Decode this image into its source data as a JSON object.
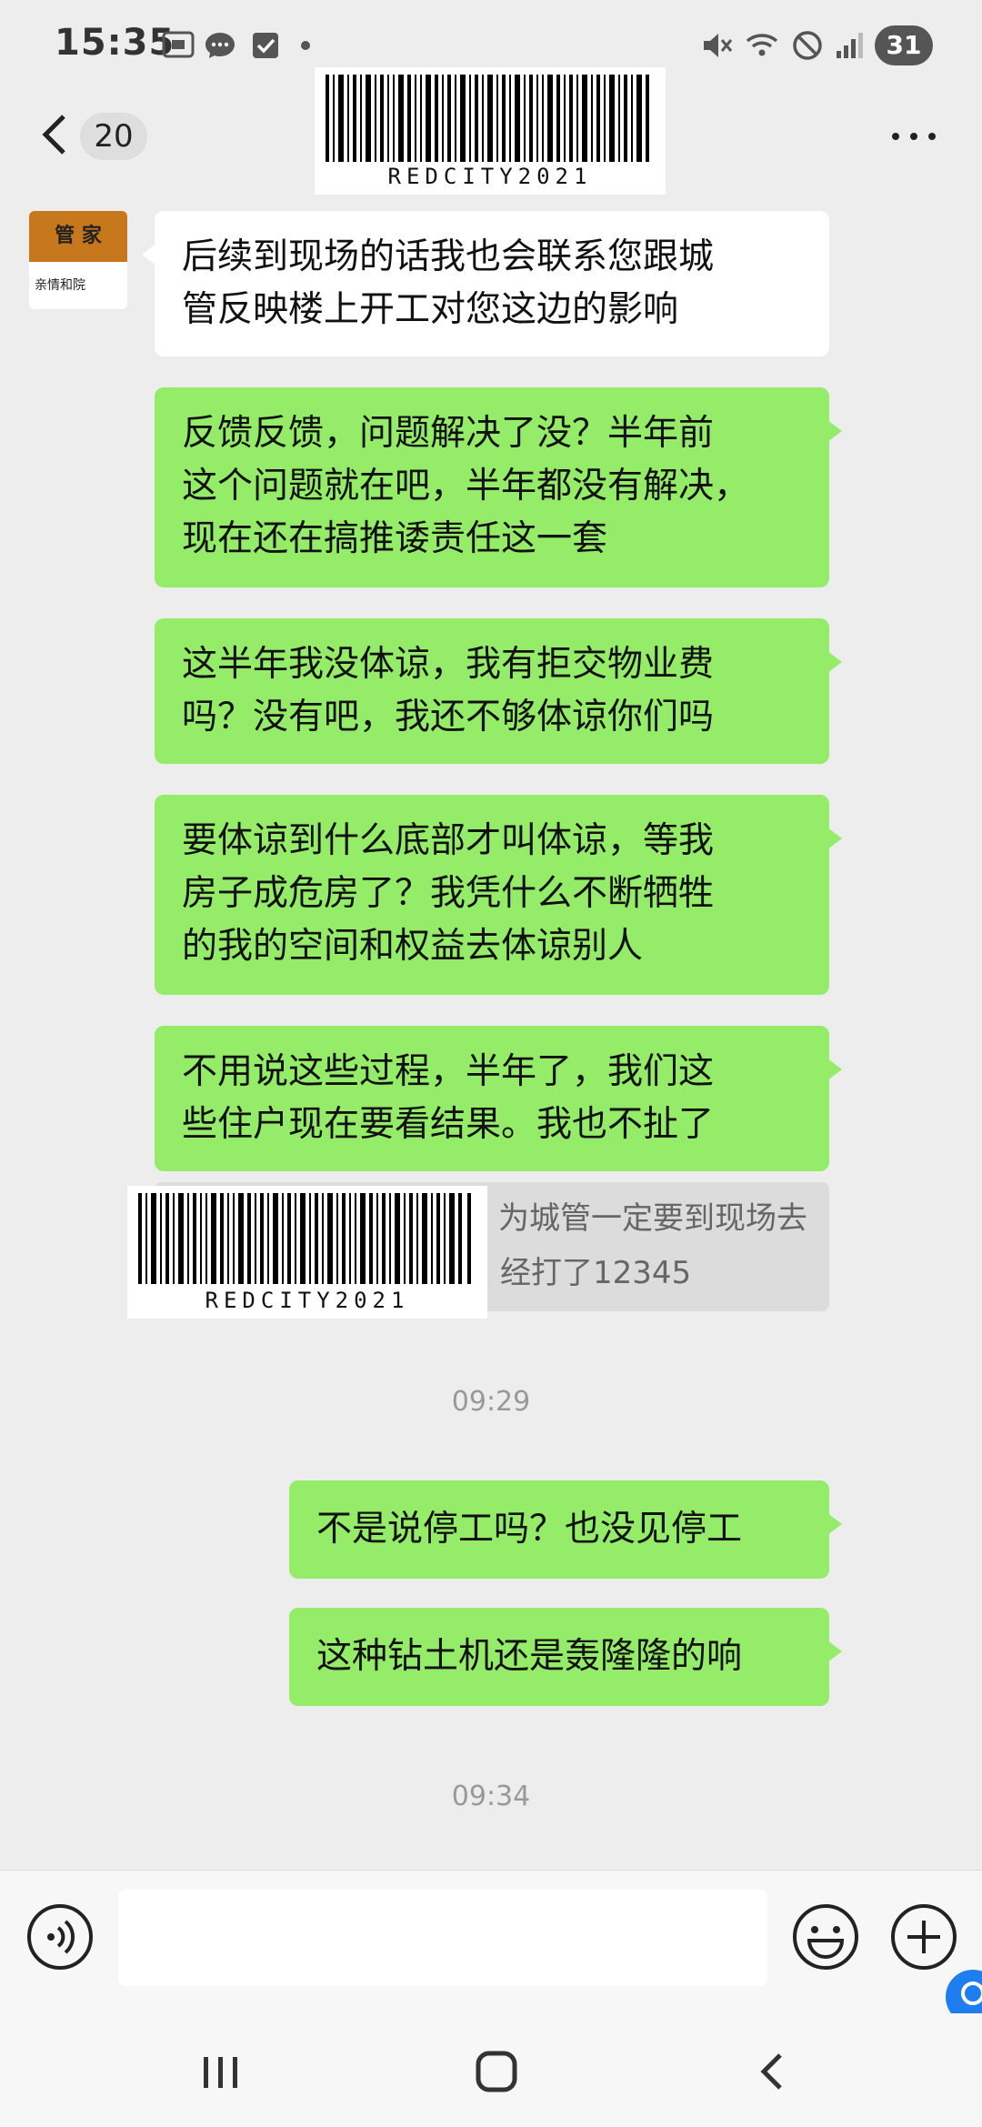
{
  "status_bar": {
    "time": "15:35",
    "left_icons": [
      "screenshot-icon",
      "chat-bubble-icon",
      "checkbox-icon",
      "dot-icon"
    ],
    "right_icons": [
      "mute-icon",
      "wifi-icon",
      "do-not-disturb-icon",
      "signal-icon"
    ],
    "battery": "31"
  },
  "header": {
    "unread_count": "20"
  },
  "watermark": {
    "text": "REDCITY2021"
  },
  "avatar": {
    "top_label": "管 家",
    "bottom_label": "亲情和院"
  },
  "messages": [
    {
      "from": "received",
      "lines": [
        "后续到现场的话我也会联系您跟城",
        "管反映楼上开工对您这边的影响"
      ]
    },
    {
      "from": "sent",
      "lines": [
        "反馈反馈，问题解决了没？半年前",
        "这个问题就在吧，半年都没有解决，",
        "现在还在搞推诿责任这一套"
      ]
    },
    {
      "from": "sent",
      "lines": [
        "这半年我没体谅，我有拒交物业费",
        "吗？没有吧，我还不够体谅你们吗"
      ]
    },
    {
      "from": "sent",
      "lines": [
        "要体谅到什么底部才叫体谅，等我",
        "房子成危房了？我凭什么不断牺牲",
        "的我的空间和权益去体谅别人"
      ]
    },
    {
      "from": "sent",
      "lines": [
        "不用说这些过程，半年了，我们这",
        "些住户现在要看结果。我也不扯了"
      ]
    }
  ],
  "quote": {
    "lines": [
      "为城管一定要到现场去",
      "经打了12345"
    ]
  },
  "timestamps": [
    "09:29",
    "09:34"
  ],
  "later_messages": [
    {
      "from": "sent",
      "text": "不是说停工吗？也没见停工"
    },
    {
      "from": "sent",
      "text": "这种钻土机还是轰隆隆的响"
    }
  ],
  "input": {
    "value": "",
    "placeholder": ""
  },
  "colors": {
    "background": "#ededed",
    "sent_bubble": "#95ec69",
    "received_bubble": "#ffffff",
    "quote_bubble": "#dcdcdc",
    "avatar_accent": "#c8781c",
    "floating_button": "#1e7ef0"
  }
}
